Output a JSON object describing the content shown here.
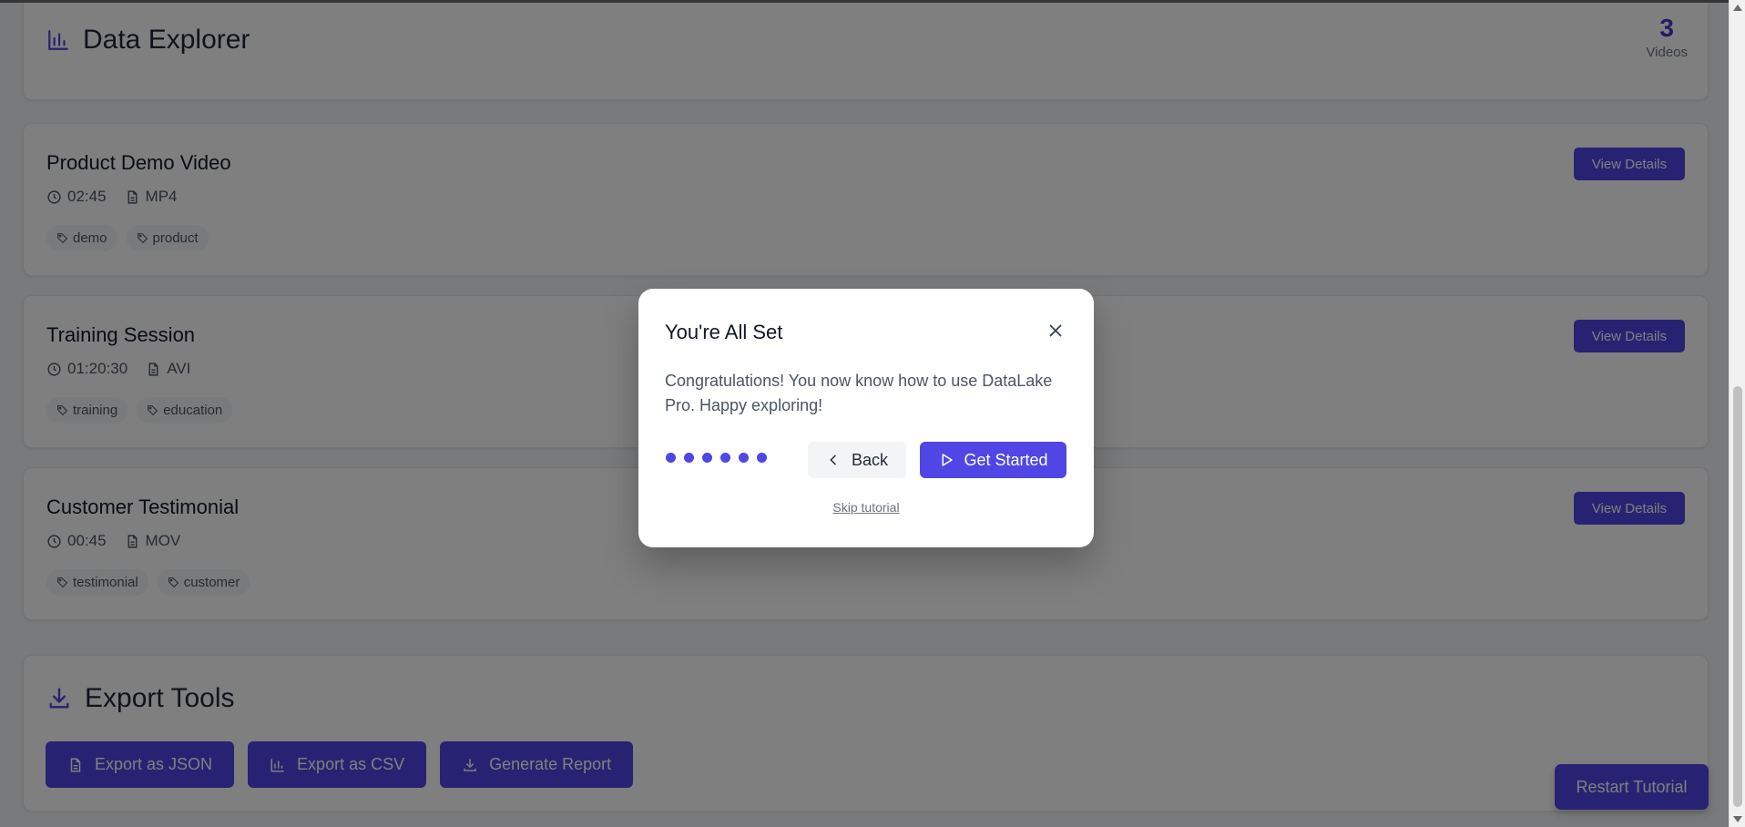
{
  "header": {
    "title": "Data Explorer",
    "count": "3",
    "count_label": "Videos"
  },
  "videos": [
    {
      "title": "Product Demo Video",
      "duration": "02:45",
      "format": "MP4",
      "tags": [
        "demo",
        "product"
      ],
      "action": "View Details"
    },
    {
      "title": "Training Session",
      "duration": "01:20:30",
      "format": "AVI",
      "tags": [
        "training",
        "education"
      ],
      "action": "View Details"
    },
    {
      "title": "Customer Testimonial",
      "duration": "00:45",
      "format": "MOV",
      "tags": [
        "testimonial",
        "customer"
      ],
      "action": "View Details"
    }
  ],
  "export": {
    "title": "Export Tools",
    "buttons": [
      "Export as JSON",
      "Export as CSV",
      "Generate Report"
    ]
  },
  "restart_label": "Restart Tutorial",
  "modal": {
    "title": "You're All Set",
    "body": "Congratulations! You now know how to use DataLake Pro. Happy exploring!",
    "step_count": 6,
    "back_label": "Back",
    "start_label": "Get Started",
    "skip_label": "Skip tutorial"
  },
  "colors": {
    "accent": "#4f46e5",
    "accent_dark": "#4338ca",
    "overlay": "rgba(0,0,0,0.5)"
  }
}
